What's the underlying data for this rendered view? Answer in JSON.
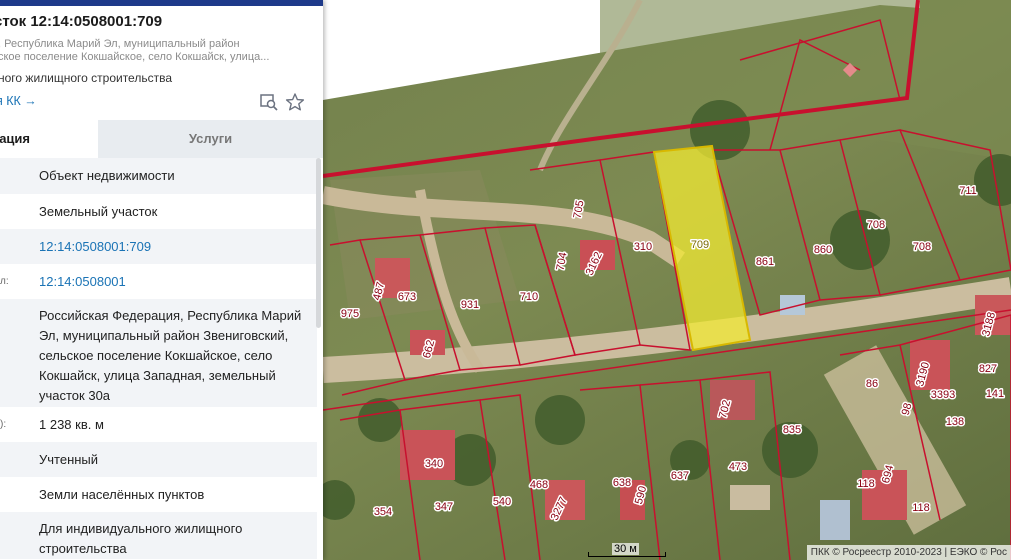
{
  "panel": {
    "title": "сток 12:14:0508001:709",
    "address_line1": ", Республика Марий Эл, муниципальный район",
    "address_line2": "ское поселение Кокшайское, село Кокшайск, улица...",
    "purpose": "ного жилищного строительства",
    "kk_link": "я КК →",
    "icons": {
      "search_on_map": "search-map-icon",
      "favorite": "star-icon"
    },
    "tabs": {
      "info": "ация",
      "services": "Услуги"
    },
    "rows": [
      {
        "key": "",
        "value": "Объект недвижимости"
      },
      {
        "key": "",
        "value": "Земельный участок"
      },
      {
        "key": "",
        "value": "12:14:0508001:709"
      },
      {
        "key": "л:",
        "value": "12:14:0508001"
      },
      {
        "key": "",
        "value": "Российская Федерация, Республика Марий Эл, муниципальный район Звениговский, сельское поселение Кокшайское, село Кокшайск, улица Западная, земельный участок 30а"
      },
      {
        "key": "):",
        "value": "1 238 кв. м"
      },
      {
        "key": "",
        "value": "Учтенный"
      },
      {
        "key": "",
        "value": "Земли населённых пунктов"
      },
      {
        "key": "",
        "value": "Для индивидуального жилищного строительства"
      }
    ]
  },
  "map": {
    "selected_parcel": "709",
    "parcel_labels": [
      "705",
      "310",
      "709",
      "704",
      "3162",
      "861",
      "860",
      "708",
      "708",
      "711",
      "487",
      "673",
      "931",
      "710",
      "975",
      "662",
      "3188",
      "86",
      "3190",
      "3393",
      "827",
      "141",
      "138",
      "98",
      "702",
      "835",
      "473",
      "340",
      "540",
      "468",
      "3277",
      "638",
      "590",
      "637",
      "694",
      "118",
      "118",
      "354",
      "347"
    ],
    "scale_label": "30 м",
    "copyright": "ПКК © Росреестр 2010-2023 | ЕЭКО © Рос",
    "colors": {
      "boundary": "#c8102e",
      "selected_fill": "#f2ea33",
      "selected_stroke": "#d8b800"
    }
  }
}
